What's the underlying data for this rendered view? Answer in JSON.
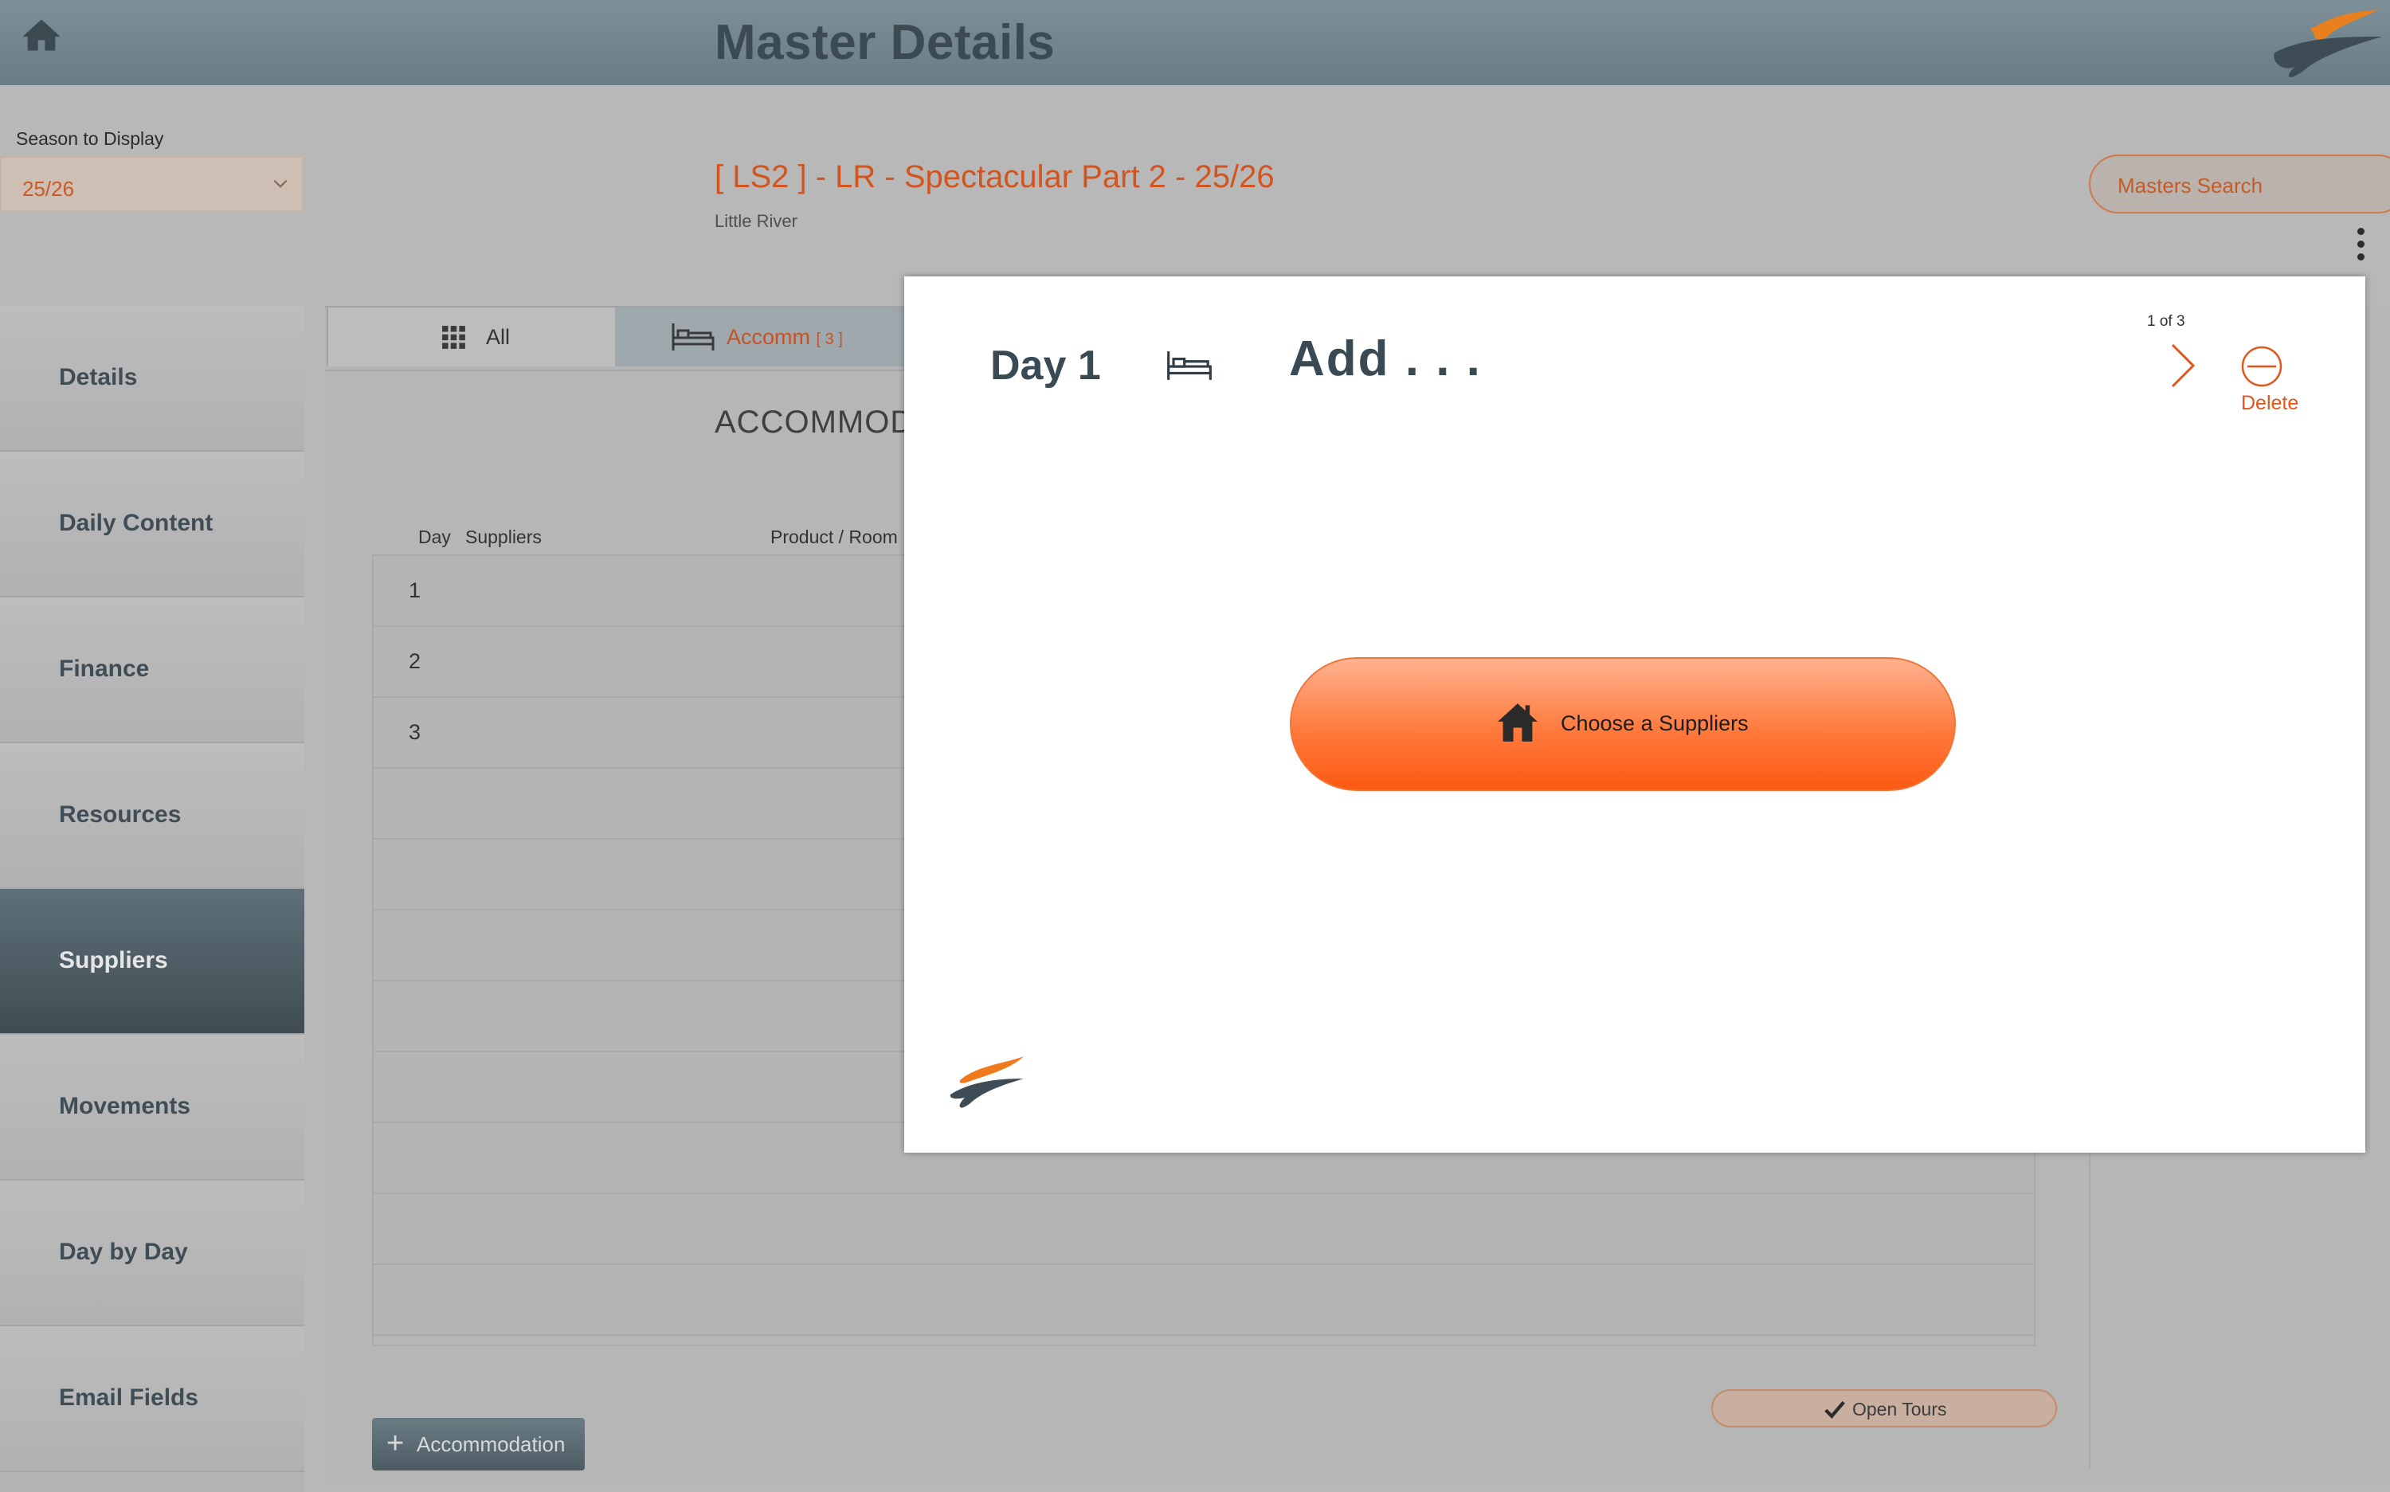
{
  "header": {
    "title": "Master Details"
  },
  "season": {
    "label": "Season to Display",
    "value": "25/26"
  },
  "tour": {
    "title": "[ LS2 ] - LR - Spectacular Part 2 - 25/26",
    "subtitle": "Little River"
  },
  "search": {
    "label": "Masters Search"
  },
  "sidebar": {
    "items": [
      {
        "label": "Details"
      },
      {
        "label": "Daily Content"
      },
      {
        "label": "Finance"
      },
      {
        "label": "Resources"
      },
      {
        "label": "Suppliers"
      },
      {
        "label": "Movements"
      },
      {
        "label": "Day by Day"
      },
      {
        "label": "Email Fields"
      }
    ],
    "active": "Suppliers"
  },
  "tabs": {
    "all": "All",
    "accomm": "Accomm",
    "accomm_count": "[ 3 ]"
  },
  "main": {
    "heading": "ACCOMMOD",
    "columns": {
      "day": "Day",
      "suppliers": "Suppliers",
      "product": "Product / Room"
    },
    "rows": [
      {
        "day": "1"
      },
      {
        "day": "2"
      },
      {
        "day": "3"
      },
      {
        "day": ""
      },
      {
        "day": ""
      },
      {
        "day": ""
      },
      {
        "day": ""
      },
      {
        "day": ""
      },
      {
        "day": ""
      },
      {
        "day": ""
      },
      {
        "day": ""
      }
    ],
    "add_button": "Accommodation",
    "open_tours": "Open Tours"
  },
  "modal": {
    "day": "Day 1",
    "add_title": "Add . . .",
    "pager": "1 of 3",
    "delete_label": "Delete",
    "choose_button": "Choose a Suppliers"
  },
  "colors": {
    "accent": "#e2561b",
    "header": "#6f838c",
    "active_sidebar": "#4b5a61"
  }
}
